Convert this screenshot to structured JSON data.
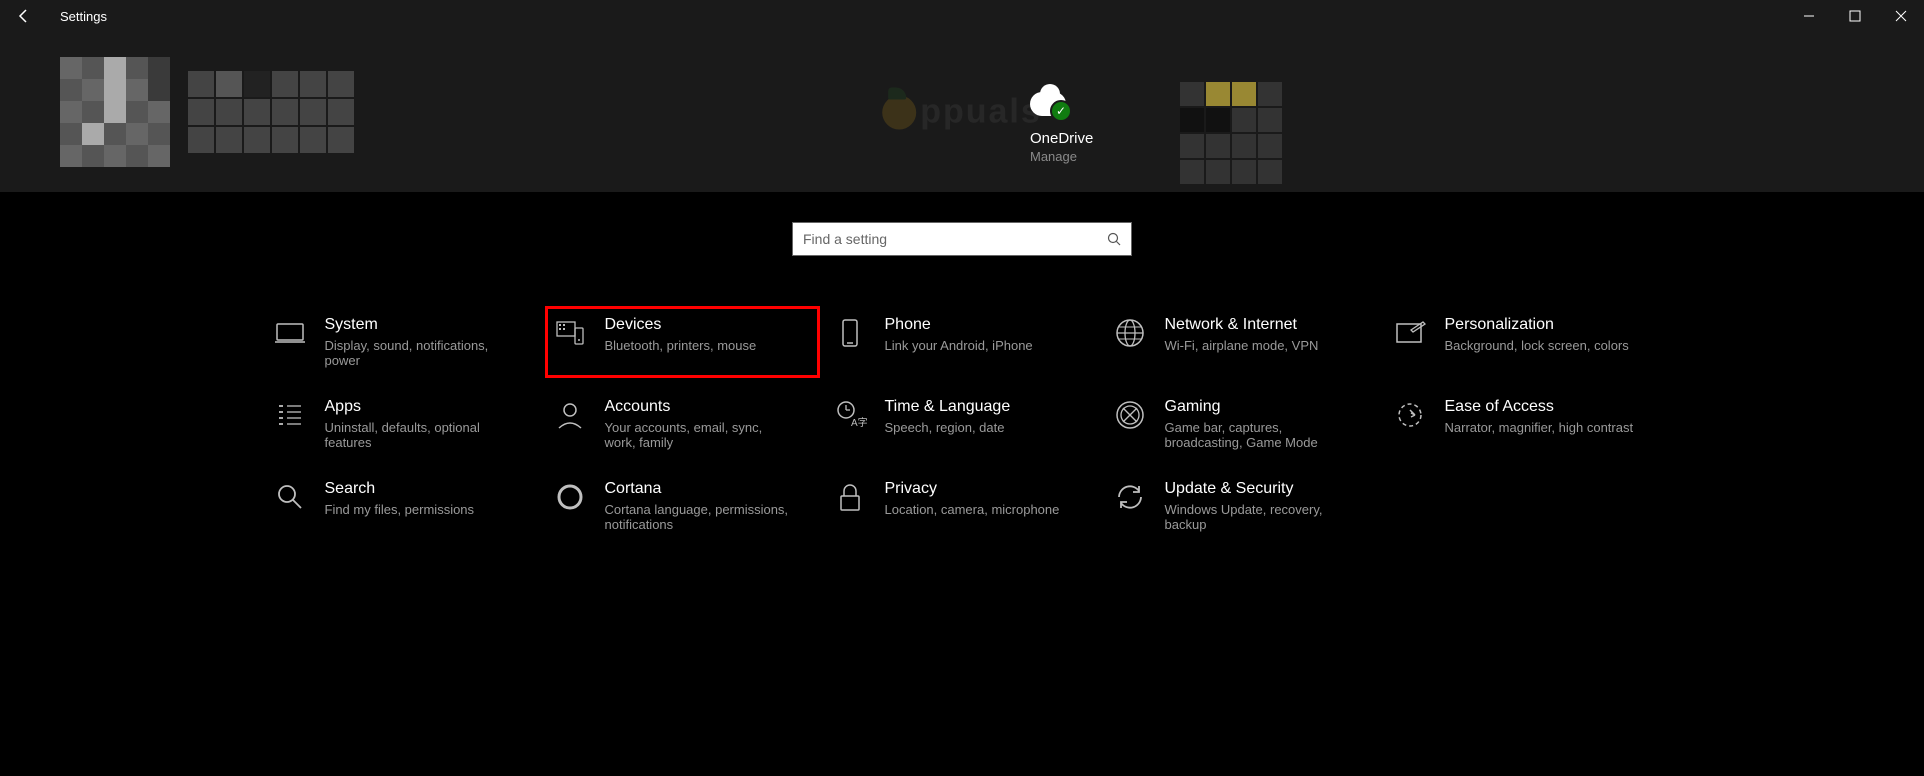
{
  "window": {
    "title": "Settings"
  },
  "onedrive": {
    "title": "OneDrive",
    "subtitle": "Manage"
  },
  "search": {
    "placeholder": "Find a setting"
  },
  "watermark": {
    "text": "ppuals"
  },
  "settings": [
    {
      "key": "system",
      "title": "System",
      "sub": "Display, sound, notifications, power",
      "highlight": false
    },
    {
      "key": "devices",
      "title": "Devices",
      "sub": "Bluetooth, printers, mouse",
      "highlight": true
    },
    {
      "key": "phone",
      "title": "Phone",
      "sub": "Link your Android, iPhone",
      "highlight": false
    },
    {
      "key": "network",
      "title": "Network & Internet",
      "sub": "Wi-Fi, airplane mode, VPN",
      "highlight": false
    },
    {
      "key": "personalization",
      "title": "Personalization",
      "sub": "Background, lock screen, colors",
      "highlight": false
    },
    {
      "key": "apps",
      "title": "Apps",
      "sub": "Uninstall, defaults, optional features",
      "highlight": false
    },
    {
      "key": "accounts",
      "title": "Accounts",
      "sub": "Your accounts, email, sync, work, family",
      "highlight": false
    },
    {
      "key": "time",
      "title": "Time & Language",
      "sub": "Speech, region, date",
      "highlight": false
    },
    {
      "key": "gaming",
      "title": "Gaming",
      "sub": "Game bar, captures, broadcasting, Game Mode",
      "highlight": false
    },
    {
      "key": "ease",
      "title": "Ease of Access",
      "sub": "Narrator, magnifier, high contrast",
      "highlight": false
    },
    {
      "key": "search",
      "title": "Search",
      "sub": "Find my files, permissions",
      "highlight": false
    },
    {
      "key": "cortana",
      "title": "Cortana",
      "sub": "Cortana language, permissions, notifications",
      "highlight": false
    },
    {
      "key": "privacy",
      "title": "Privacy",
      "sub": "Location, camera, microphone",
      "highlight": false
    },
    {
      "key": "update",
      "title": "Update & Security",
      "sub": "Windows Update, recovery, backup",
      "highlight": false
    }
  ]
}
